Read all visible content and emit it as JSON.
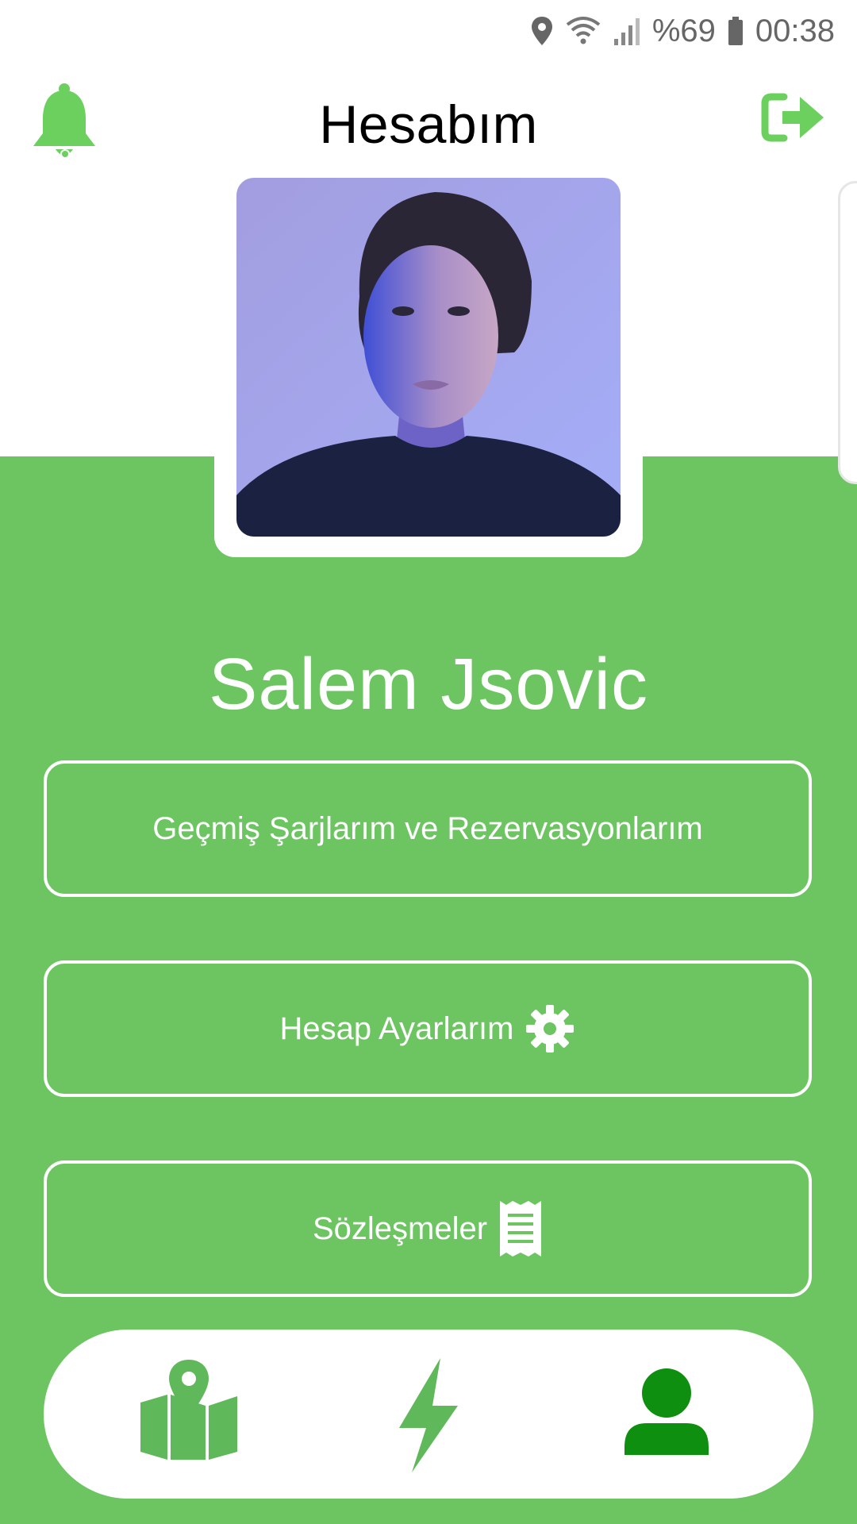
{
  "status_bar": {
    "battery": "%69",
    "time": "00:38",
    "icons": [
      "location-pin-icon",
      "wifi-icon",
      "signal-icon",
      "battery-icon"
    ]
  },
  "header": {
    "title": "Hesabım",
    "left_icon": "bell-icon",
    "right_icon": "logout-icon"
  },
  "profile": {
    "name": "Salem Jsovic",
    "avatar": "profile-photo"
  },
  "menu": {
    "history_label": "Geçmiş Şarjlarım ve Rezervasyonlarım",
    "settings_label": "Hesap Ayarlarım",
    "settings_icon": "gear-icon",
    "contracts_label": "Sözleşmeler",
    "contracts_icon": "receipt-icon"
  },
  "bottom_nav": {
    "items": [
      {
        "icon": "map-icon",
        "active": false
      },
      {
        "icon": "lightning-icon",
        "active": false
      },
      {
        "icon": "user-icon",
        "active": true
      }
    ]
  },
  "colors": {
    "primary_green": "#6cc561",
    "active_green": "#0f8f0f",
    "icon_green": "#5fb85a",
    "white": "#ffffff"
  }
}
